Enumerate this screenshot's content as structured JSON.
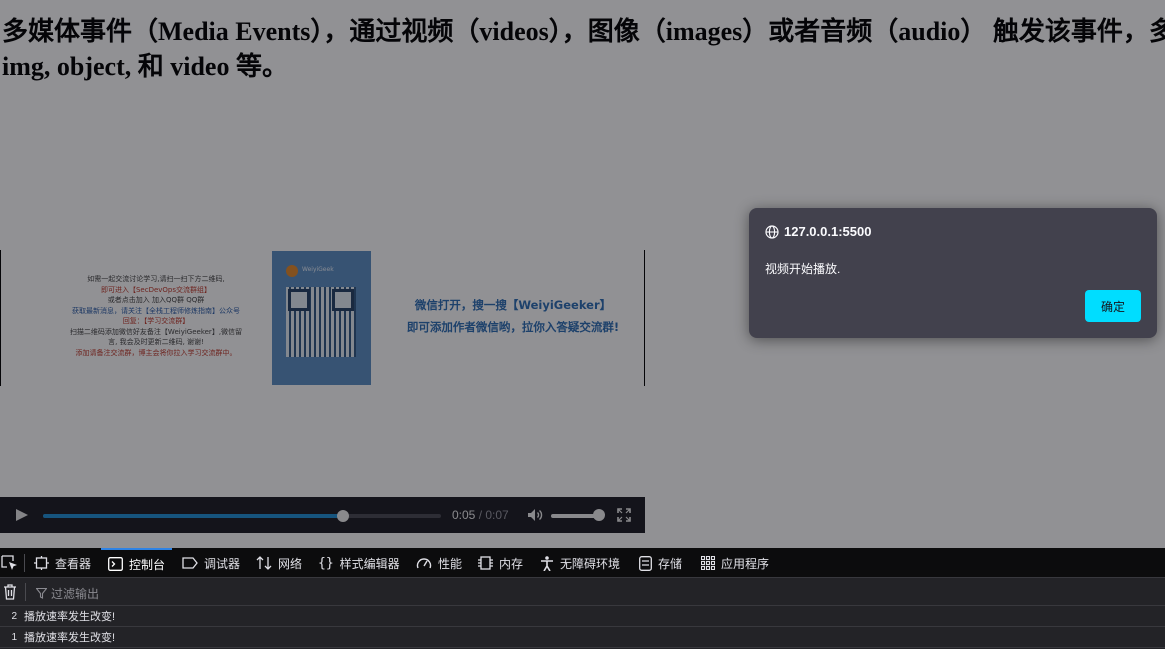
{
  "page": {
    "heading": "多媒体事件（Media Events），通过视频（videos），图像（images）或者音频（audio） 触发该事件，多应用于HTML媒体元素比如 <audio>, <embed>,",
    "heading_line2": "img, object, 和 video 等。"
  },
  "video_frame": {
    "left_lines": [
      "如需一起交流讨论学习,请扫一扫下方二维码,",
      "即可进入【SecDevOps交流群组】",
      "或者点击加入 加入QQ群 QQ群",
      "获取最新消息，请关注【全栈工程师修炼指南】公众号",
      "回复：【学习交流群】",
      "扫描二维码添加微信好友备注【WeiyiGeeker】,微信留",
      "言, 我会及时更新二维码, 谢谢!",
      "添加请备注交流群，博主会将你拉入学习交流群中。"
    ],
    "qr_name": "WeiyiGeek",
    "promo_line1": "微信打开，搜一搜【WeiyiGeeker】",
    "promo_line2": "即可添加作者微信哟，拉你入答疑交流群!"
  },
  "player": {
    "progress": 0.755,
    "current_time": "0:05",
    "separator": " / ",
    "duration": "0:07",
    "volume": 1.0
  },
  "dialog": {
    "origin": "127.0.0.1:5500",
    "message": "视频开始播放.",
    "ok_label": "确定",
    "accent": "#00ddff"
  },
  "devtools": {
    "tabs": [
      {
        "label": "查看器",
        "icon": "inspector-icon"
      },
      {
        "label": "控制台",
        "icon": "console-icon",
        "active": true
      },
      {
        "label": "调试器",
        "icon": "debugger-icon"
      },
      {
        "label": "网络",
        "icon": "network-icon"
      },
      {
        "label": "样式编辑器",
        "icon": "style-editor-icon"
      },
      {
        "label": "性能",
        "icon": "performance-icon"
      },
      {
        "label": "内存",
        "icon": "memory-icon"
      },
      {
        "label": "无障碍环境",
        "icon": "accessibility-icon"
      },
      {
        "label": "存储",
        "icon": "storage-icon"
      },
      {
        "label": "应用程序",
        "icon": "application-icon"
      }
    ],
    "filter_placeholder": "过滤输出",
    "logs": [
      {
        "count": "2",
        "text": "播放速率发生改变!"
      },
      {
        "count": "1",
        "text": "播放速率发生改变!"
      }
    ]
  }
}
